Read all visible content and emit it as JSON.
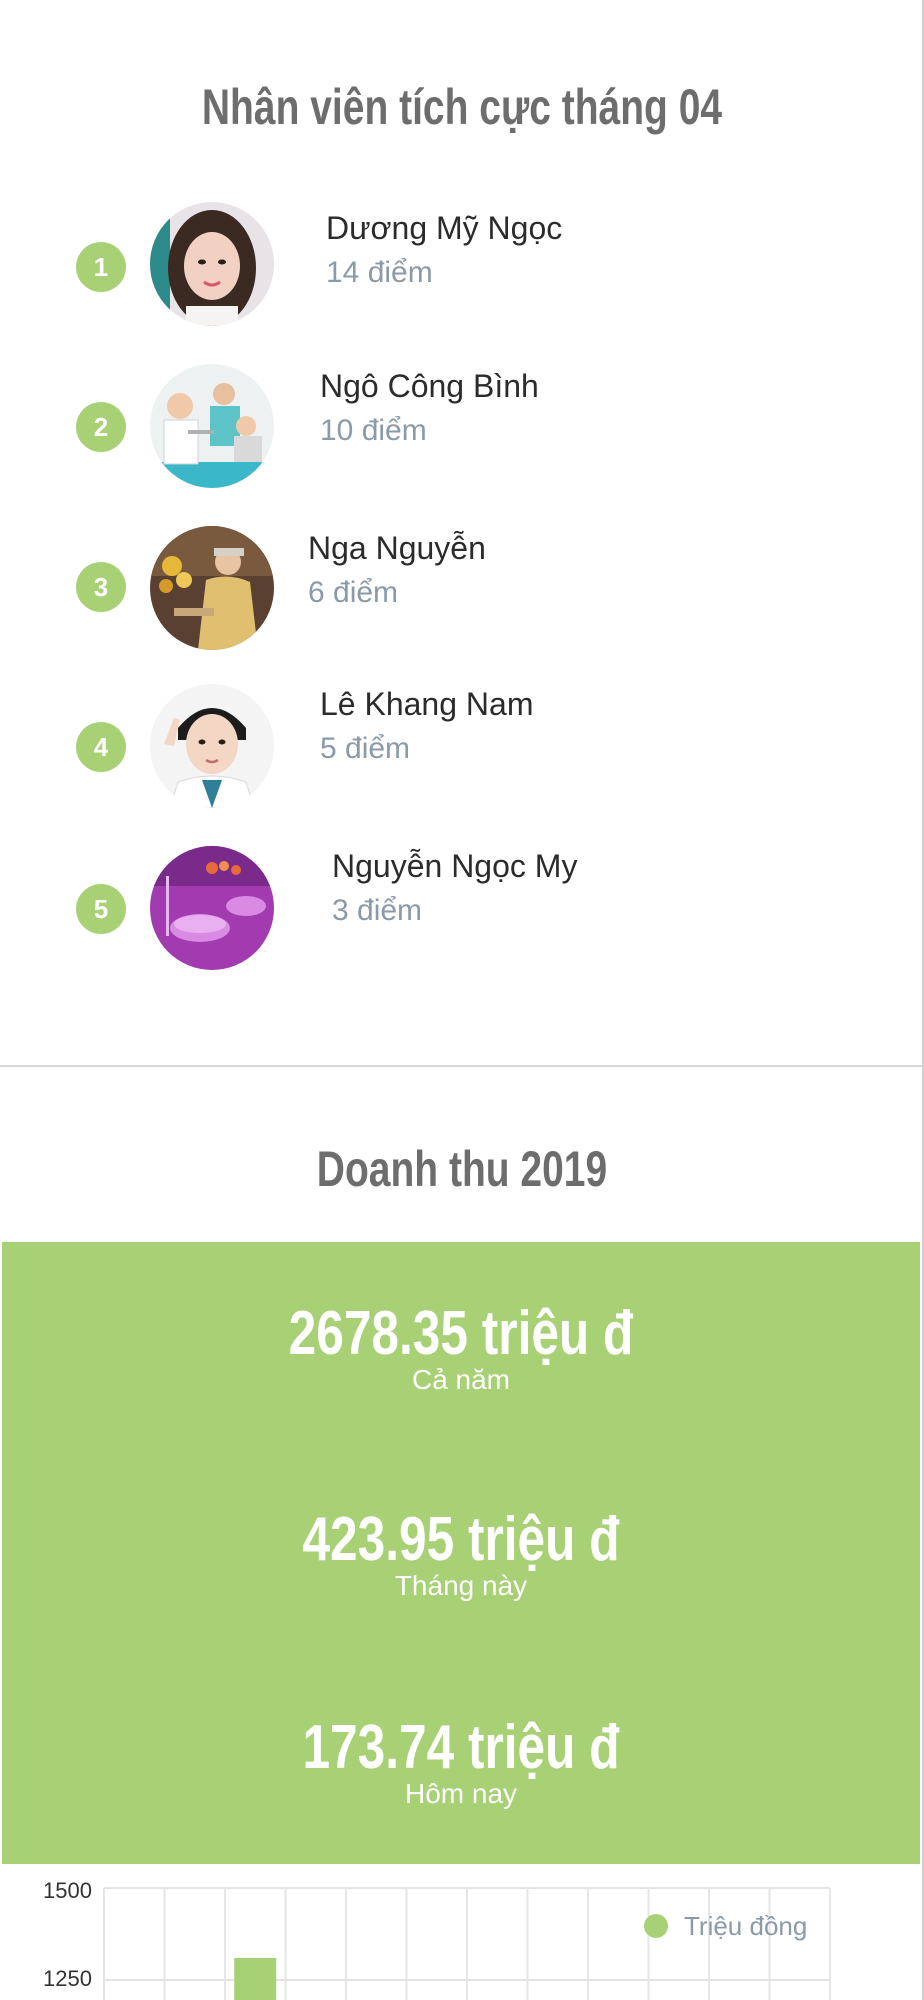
{
  "employees_section": {
    "title": "Nhân viên tích cực tháng 04",
    "ranking": [
      {
        "rank": "1",
        "name": "Dương Mỹ Ngọc",
        "score": "14 điểm",
        "avatar_icon": "avatar-photo-woman"
      },
      {
        "rank": "2",
        "name": "Ngô Công Bình",
        "score": "10 điểm",
        "avatar_icon": "avatar-photo-dental-clinic"
      },
      {
        "rank": "3",
        "name": "Nga Nguyễn",
        "score": "6 điểm",
        "avatar_icon": "avatar-photo-woman-flowers"
      },
      {
        "rank": "4",
        "name": "Lê Khang Nam",
        "score": "5 điểm",
        "avatar_icon": "avatar-photo-doctor"
      },
      {
        "rank": "5",
        "name": "Nguyễn Ngọc My",
        "score": "3 điểm",
        "avatar_icon": "avatar-photo-purple-dishes"
      }
    ]
  },
  "revenue_section": {
    "title": "Doanh thu 2019",
    "stats": [
      {
        "value": "2678.35 triệu đ",
        "label": "Cả năm"
      },
      {
        "value": "423.95 triệu đ",
        "label": "Tháng này"
      },
      {
        "value": "173.74 triệu đ",
        "label": "Hôm nay"
      }
    ]
  },
  "colors": {
    "accent": "#a8d175",
    "title": "#6d6d6d",
    "score": "#8a9aa8"
  },
  "chart_data": {
    "type": "bar",
    "legend": {
      "label": "Triệu đồng",
      "placement": "top-right"
    },
    "y_ticks": [
      "1500",
      "1250"
    ],
    "ylim_visible": [
      1250,
      1500
    ],
    "grid": true,
    "series": [
      {
        "name": "Triệu đồng",
        "values": [
          null,
          null,
          1310
        ]
      }
    ],
    "note_visible_portion": "partial"
  }
}
